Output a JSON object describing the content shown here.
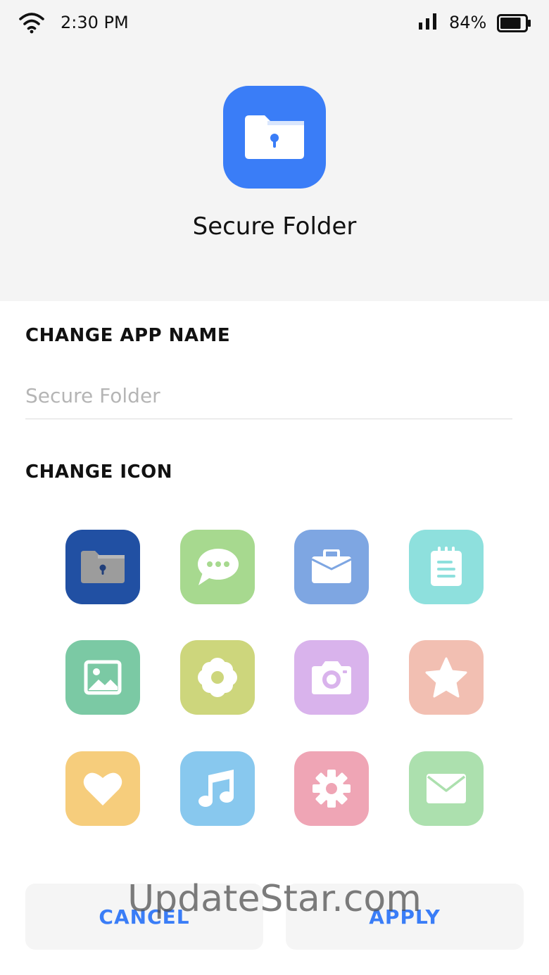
{
  "status_bar": {
    "time": "2:30 PM",
    "battery_percent": "84%",
    "battery_level": 0.84,
    "icons": [
      "wifi-icon",
      "signal-icon",
      "battery-icon"
    ]
  },
  "app": {
    "name": "Secure Folder",
    "icon": "secure-folder-icon",
    "accent_color": "#3a7df7"
  },
  "change_name": {
    "title": "CHANGE APP NAME",
    "placeholder": "Secure Folder",
    "value": ""
  },
  "change_icon": {
    "title": "CHANGE ICON",
    "icons": [
      {
        "name": "folder-lock-icon",
        "color": "#2150a3",
        "selected": true
      },
      {
        "name": "chat-icon",
        "color": "#a7d98f"
      },
      {
        "name": "briefcase-icon",
        "color": "#7ea6e2"
      },
      {
        "name": "notepad-icon",
        "color": "#8ee0dd"
      },
      {
        "name": "image-icon",
        "color": "#7bc9a4"
      },
      {
        "name": "flower-icon",
        "color": "#cdd67c"
      },
      {
        "name": "camera-icon",
        "color": "#d9b3ec"
      },
      {
        "name": "star-icon",
        "color": "#f2bfb2"
      },
      {
        "name": "heart-icon",
        "color": "#f6cd7c"
      },
      {
        "name": "music-icon",
        "color": "#88c8ee"
      },
      {
        "name": "settings-icon",
        "color": "#efa5b5"
      },
      {
        "name": "mail-icon",
        "color": "#ace0ae"
      }
    ]
  },
  "actions": {
    "cancel_label": "CANCEL",
    "apply_label": "APPLY"
  },
  "watermark": "UpdateStar.com"
}
